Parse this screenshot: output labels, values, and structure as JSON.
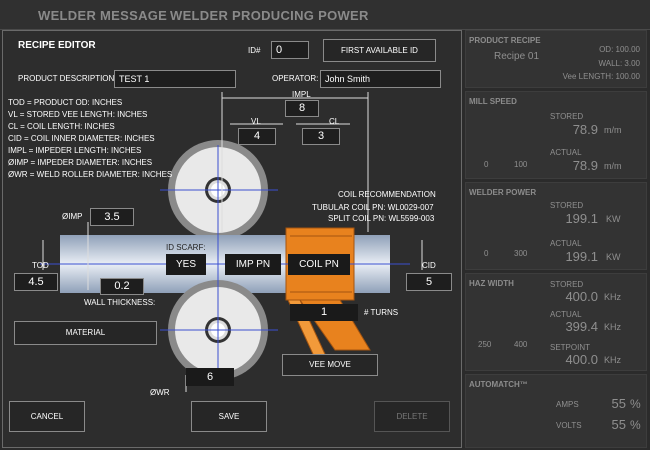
{
  "header": {
    "tab_message": "WELDER MESSAGE",
    "tab_power": "WELDER PRODUCING POWER"
  },
  "editor": {
    "title": "RECIPE EDITOR",
    "id_label": "ID#",
    "id_value": "0",
    "first_available_label": "FIRST AVAILABLE ID",
    "product_desc_label": "PRODUCT DESCRIPTION:",
    "product_desc_value": "TEST 1",
    "operator_label": "OPERATOR:",
    "operator_value": "John Smith",
    "legend": [
      "TOD =  PRODUCT OD: INCHES",
      "VL =  STORED VEE LENGTH: INCHES",
      "CL =  COIL LENGTH: INCHES",
      "CID =  COIL INNER DIAMETER: INCHES",
      "IMPL =  IMPEDER LENGTH: INCHES",
      "ØIMP =  IMPEDER DIAMETER: INCHES",
      "ØWR =  WELD ROLLER DIAMETER: INCHES"
    ],
    "impl_label": "IMPL",
    "impl_value": "8",
    "vl_label": "VL",
    "vl_value": "4",
    "cl_label": "CL",
    "cl_value": "3",
    "imp_label": "ØIMP",
    "imp_value": "3.5",
    "tod_label": "TOD",
    "tod_value": "4.5",
    "cid_label": "CID",
    "cid_value": "5",
    "id_scarf_label": "ID SCARF:",
    "id_scarf_value": "YES",
    "imp_pn_label": "IMP PN",
    "coil_pn_label": "COIL PN",
    "wall_value": "0.2",
    "wall_label": "WALL THICKNESS:",
    "material_label": "MATERIAL",
    "turns_value": "1",
    "turns_label": "# TURNS",
    "wr_label": "ØWR",
    "wr_value": "6",
    "vee_move_label": "VEE MOVE",
    "coil_rec_title": "COIL RECOMMENDATION",
    "tubular_coil": "TUBULAR COIL PN:  WL0029-007",
    "split_coil": "SPLIT COIL PN:  WL5599-003",
    "cancel_label": "CANCEL",
    "save_label": "SAVE",
    "delete_label": "DELETE"
  },
  "product_recipe": {
    "title": "PRODUCT RECIPE",
    "recipe": "Recipe 01",
    "od": "OD: 100.00",
    "wall": "WALL:      3.00",
    "vee": "Vee LENGTH: 100.00"
  },
  "mill_speed": {
    "title": "MILL SPEED",
    "stored_label": "STORED",
    "stored_value": "78.9",
    "stored_unit": "m/m",
    "actual_label": "ACTUAL",
    "actual_value": "78.9",
    "actual_unit": "m/m",
    "gauge_min": "0",
    "gauge_max": "100",
    "gauge_level": 0.79
  },
  "welder_power": {
    "title": "WELDER POWER",
    "stored_label": "STORED",
    "stored_value": "199.1",
    "stored_unit": "KW",
    "actual_label": "ACTUAL",
    "actual_value": "199.1",
    "actual_unit": "KW",
    "gauge_min": "0",
    "gauge_max": "300",
    "gauge_level": 0.66
  },
  "haz_width": {
    "title": "HAZ WIDTH",
    "stored_label": "STORED",
    "stored_value": "400.0",
    "stored_unit": "KHz",
    "actual_label": "ACTUAL",
    "actual_value": "399.4",
    "actual_unit": "KHz",
    "setpoint_label": "SETPOINT",
    "setpoint_value": "400.0",
    "setpoint_unit": "KHz",
    "gauge_min": "250",
    "gauge_max": "400"
  },
  "automatch": {
    "title": "AUTOMATCH™",
    "amps_label": "AMPS",
    "amps_value": "55",
    "amps_unit": "%",
    "volts_label": "VOLTS",
    "volts_value": "55",
    "volts_unit": "%"
  },
  "colors": {
    "coil": "#e8821e",
    "gauge_red": "#d42a2a",
    "rod": "#b8c4d6"
  }
}
